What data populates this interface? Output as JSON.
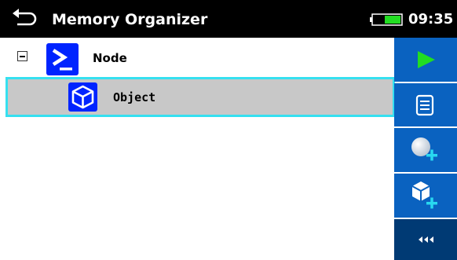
{
  "header": {
    "title": "Memory Organizer",
    "time": "09:35",
    "back_icon": "back-arrow-icon",
    "battery_icon": "battery-icon"
  },
  "tree": {
    "node": {
      "label": "Node",
      "icon": "terminal-node-icon",
      "expander": "collapse-minus-icon"
    },
    "object": {
      "label": "Object",
      "icon": "cube-object-icon",
      "selected": true
    }
  },
  "sidebar": {
    "buttons": [
      {
        "name": "run-button",
        "icon": "play-icon"
      },
      {
        "name": "view-button",
        "icon": "document-list-icon"
      },
      {
        "name": "add-measurement-button",
        "icon": "sphere-plus-icon"
      },
      {
        "name": "add-object-button",
        "icon": "cube-plus-icon"
      },
      {
        "name": "more-button",
        "icon": "triple-chevron-left-icon"
      }
    ]
  },
  "colors": {
    "header_bg": "#000000",
    "sidebar_blue": "#0a62c0",
    "sidebar_dark": "#003a74",
    "icon_blue": "#0024ff",
    "selection_border": "#35e0f0",
    "selection_bg": "#c8c8c8",
    "play_green": "#22dd22",
    "plus_cyan": "#28d8f0"
  }
}
